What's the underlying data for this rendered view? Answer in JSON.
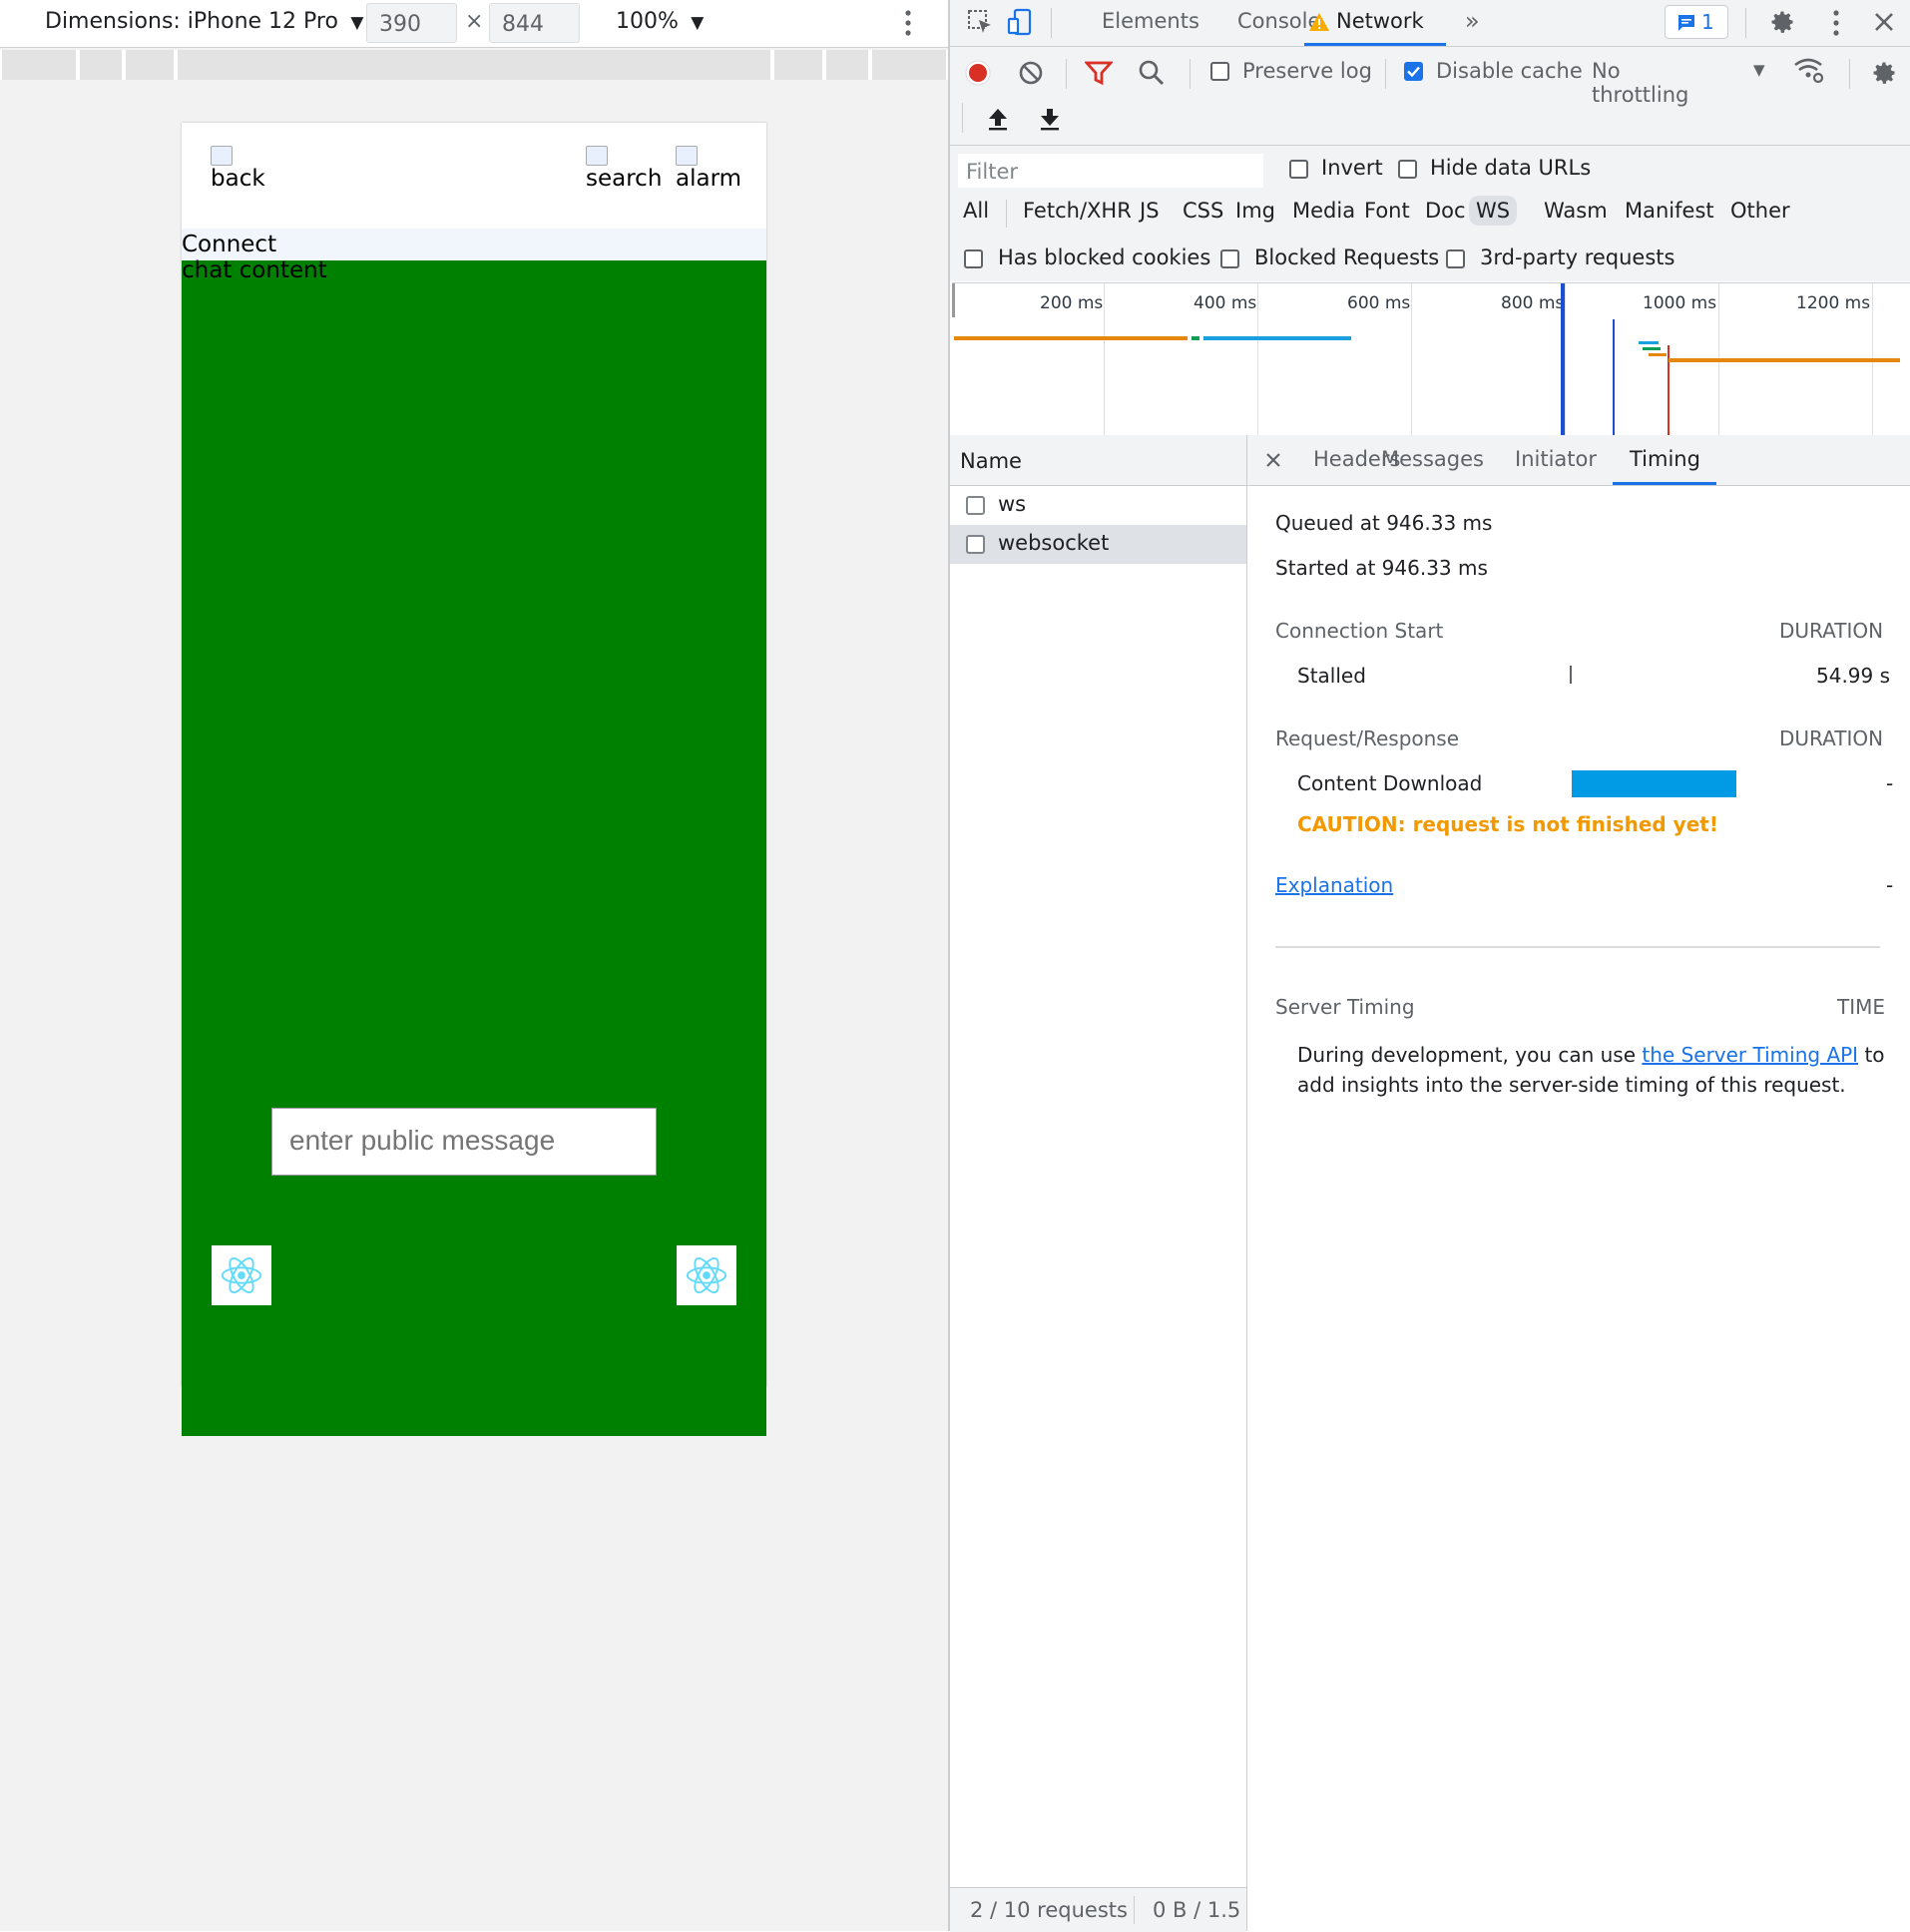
{
  "device_toolbar": {
    "dimensions_label": "Dimensions: iPhone 12 Pro",
    "width": "390",
    "times": "×",
    "height": "844",
    "zoom": "100%"
  },
  "app": {
    "nav": {
      "back_alt": "back",
      "search_alt": "search",
      "alarm_alt": "alarm"
    },
    "connect_label": "Connect",
    "chat_label": "chat content",
    "message_placeholder": "enter public message"
  },
  "devtools": {
    "tabs": [
      "Elements",
      "Console",
      "Network"
    ],
    "message_badge": "1",
    "toolbar": {
      "preserve_log": "Preserve log",
      "disable_cache": "Disable cache",
      "throttling": "No throttling"
    },
    "filter": {
      "placeholder": "Filter",
      "invert": "Invert",
      "hide_data_urls": "Hide data URLs",
      "types": [
        "All",
        "Fetch/XHR",
        "JS",
        "CSS",
        "Img",
        "Media",
        "Font",
        "Doc",
        "WS",
        "Wasm",
        "Manifest",
        "Other"
      ],
      "active_type": "WS",
      "has_blocked_cookies": "Has blocked cookies",
      "blocked_requests": "Blocked Requests",
      "third_party": "3rd-party requests"
    },
    "overview_ticks": [
      "200 ms",
      "400 ms",
      "600 ms",
      "800 ms",
      "1000 ms",
      "1200 ms"
    ],
    "requests": {
      "header": "Name",
      "items": [
        "ws",
        "websocket"
      ],
      "status": "2 / 10 requests",
      "transfer": "0 B / 1.5"
    },
    "detail_tabs": [
      "Headers",
      "Messages",
      "Initiator",
      "Timing"
    ],
    "timing": {
      "queued": "Queued at 946.33 ms",
      "started": "Started at 946.33 ms",
      "connection_start": "Connection Start",
      "duration_label": "DURATION",
      "stalled_label": "Stalled",
      "stalled_value": "54.99 s",
      "request_response": "Request/Response",
      "content_download": "Content Download",
      "content_download_value": "-",
      "caution": "CAUTION: request is not finished yet!",
      "explanation": "Explanation",
      "explanation_value": "-",
      "server_timing": "Server Timing",
      "time_label": "TIME",
      "server_text_before": "During development, you can use ",
      "server_link": "the Server Timing API",
      "server_text_after": " to",
      "server_text_line2": "add insights into the server-side timing of this request."
    },
    "colors": {
      "accent": "#1a73e8",
      "caution": "#f29900",
      "download_bar": "#009ae5",
      "record": "#d93025"
    }
  }
}
